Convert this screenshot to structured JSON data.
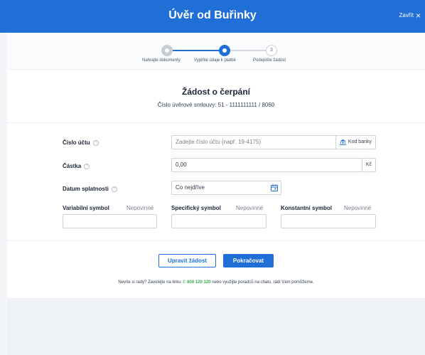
{
  "header": {
    "title": "Úvěr od Buřinky",
    "close_label": "Zavřít"
  },
  "steps": [
    {
      "number": "1",
      "label": "Nahrajte dokumenty",
      "state": "done"
    },
    {
      "number": "2",
      "label": "Vyplňte údaje k platbě",
      "state": "active"
    },
    {
      "number": "3",
      "label": "Podepište žádost",
      "state": "todo"
    }
  ],
  "form": {
    "title": "Žádost o čerpání",
    "subtitle": "Číslo úvěrové smlouvy: 51 - 1111111111 / 8060",
    "account": {
      "label": "Číslo účtu",
      "placeholder": "Zadejte číslo účtu (např. 19-4175)",
      "bank_code_label": "Kod banky"
    },
    "amount": {
      "label": "Částka",
      "value": "0,00",
      "currency": "Kč"
    },
    "due_date": {
      "label": "Datum splatnosti",
      "value": "Co nejdříve"
    },
    "variable_symbol": {
      "label": "Variabilní symbol",
      "optional": "Nepovinné",
      "value": ""
    },
    "specific_symbol": {
      "label": "Specifický symbol",
      "optional": "Nepovinné",
      "value": ""
    },
    "constant_symbol": {
      "label": "Konstantní symbol",
      "optional": "Nepovinné",
      "value": ""
    }
  },
  "actions": {
    "edit_label": "Upravit žádost",
    "continue_label": "Pokračovat"
  },
  "help": {
    "prefix": "Nevíte si rady? Zavolejte na linku",
    "phone": "800 120 120",
    "suffix": "nebo využijte poradců na chatu, rádi Vám pomůžeme."
  },
  "colors": {
    "brand": "#1f6fd6",
    "phone": "#2eae4a"
  }
}
